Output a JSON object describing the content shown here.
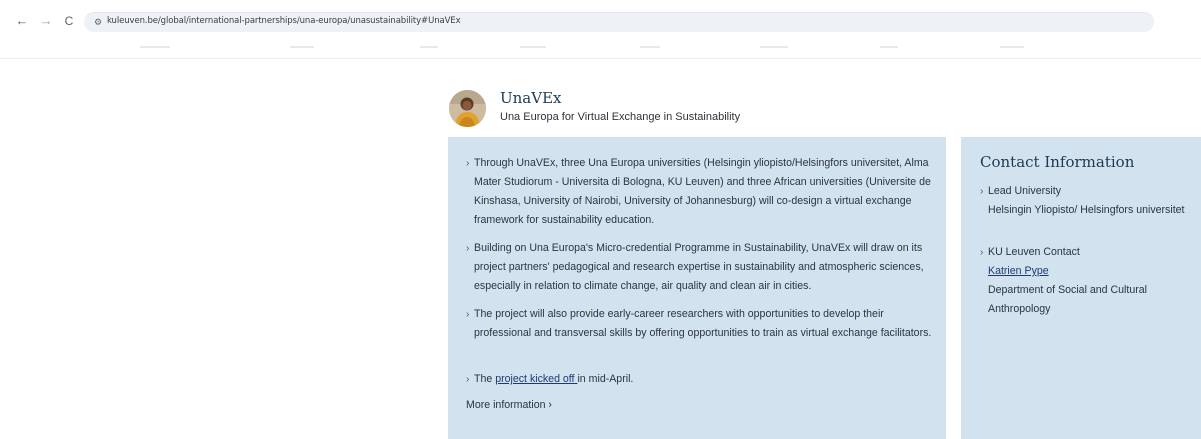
{
  "browser": {
    "url": "kuleuven.be/global/international-partnerships/una-europa/unasustainability#UnaVEx",
    "back_icon": "←",
    "forward_icon": "→",
    "reload_icon": "C",
    "site_info_icon": "⚙"
  },
  "project": {
    "title": "UnaVEx",
    "subtitle": "Una Europa for Virtual Exchange in Sustainability"
  },
  "main": {
    "bullet_icon": "›",
    "bullets": [
      "Through UnaVEx, three Una Europa universities (Helsingin yliopisto/Helsingfors universitet, Alma Mater Studiorum - Universita di Bologna, KU Leuven) and three African universities (Universite de Kinshasa, University of Nairobi, University of Johannesburg) will co-design a virtual exchange framework for sustainability education.",
      "Building on Una Europa's Micro-credential Programme in Sustainability, UnaVEx will draw on its project partners' pedagogical and research expertise in sustainability and atmospheric sciences, especially in relation to climate change, air quality and clean air in cities.",
      "The project will also provide early-career researchers with opportunities to develop their professional and transversal skills by offering opportunities to train as virtual exchange facilitators."
    ],
    "kickoff": {
      "prefix": "The ",
      "link": "project kicked off ",
      "suffix": "in mid-April."
    },
    "more_info": "More information ›"
  },
  "contact": {
    "title": "Contact Information",
    "lead_label": "Lead University",
    "lead_value": "Helsingin Yliopisto/ Helsingfors universitet",
    "ku_label": "KU Leuven Contact",
    "ku_name": "Katrien Pype",
    "ku_department": "Department of Social and Cultural Anthropology"
  },
  "colors": {
    "panel_bg": "#d2e3ef",
    "title_color": "#1d3a52",
    "link_color": "#1d3a70"
  }
}
